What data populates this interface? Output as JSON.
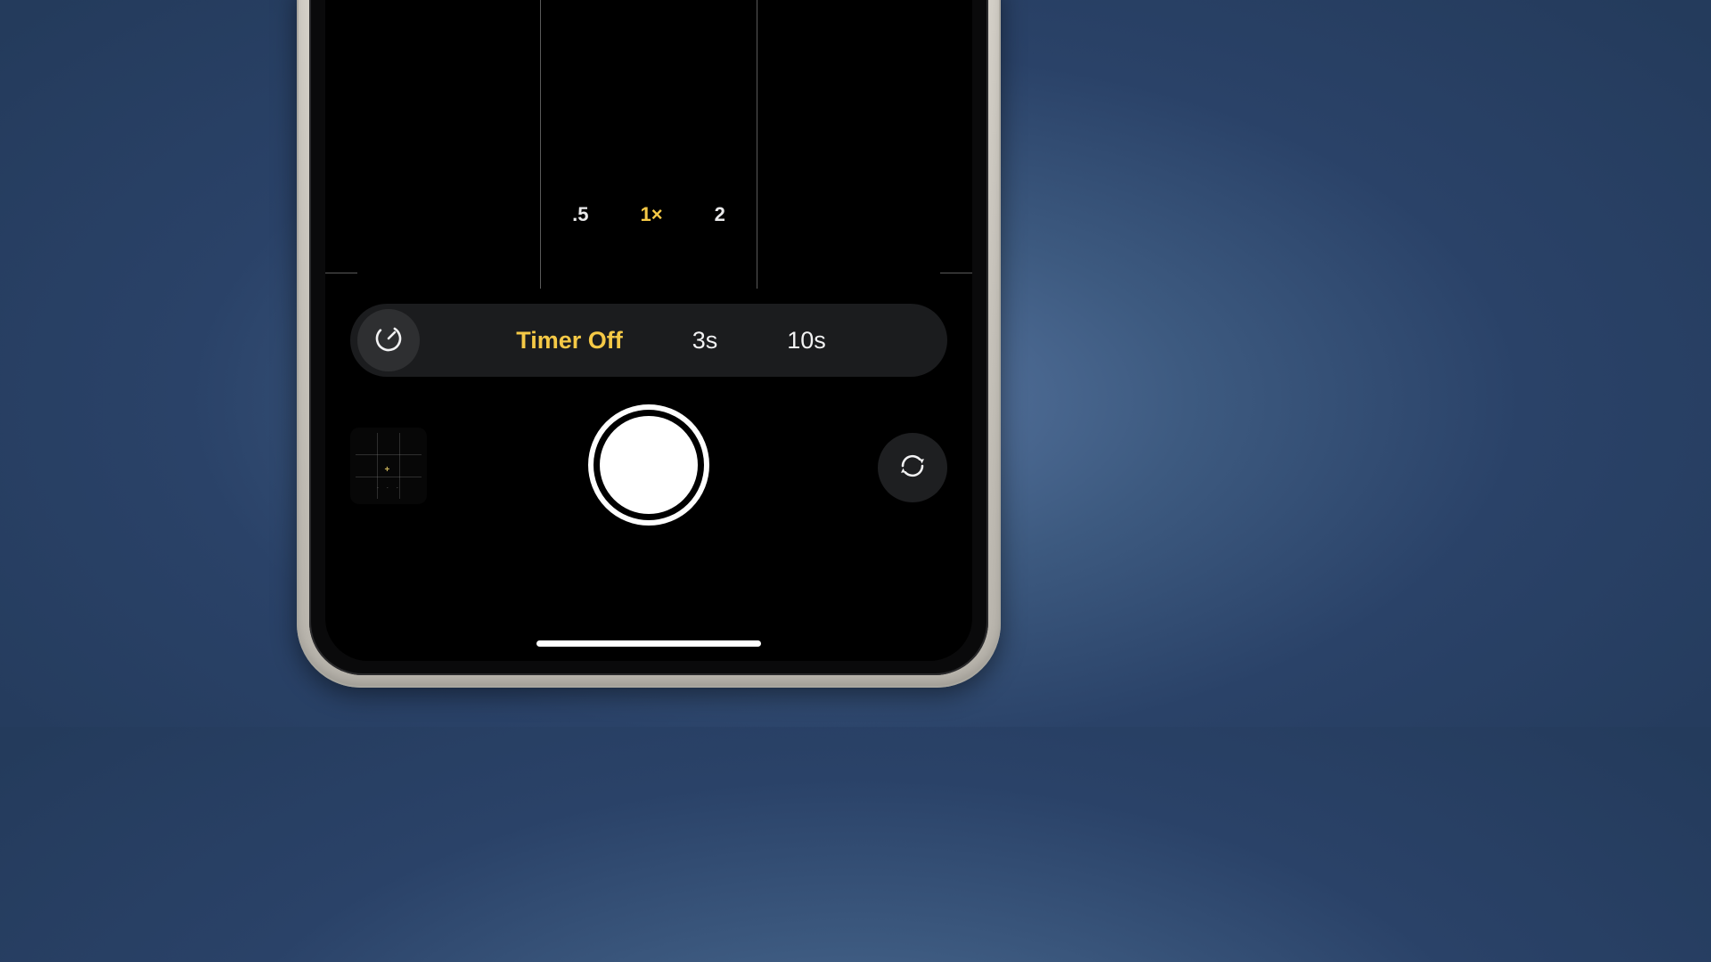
{
  "zoom": {
    "options": [
      {
        "label": ".5",
        "active": false
      },
      {
        "label": "1×",
        "active": true
      },
      {
        "label": "2",
        "active": false
      }
    ]
  },
  "timer": {
    "options": [
      {
        "label": "Timer Off",
        "active": true
      },
      {
        "label": "3s",
        "active": false
      },
      {
        "label": "10s",
        "active": false
      }
    ]
  },
  "colors": {
    "accent": "#f5c946"
  }
}
